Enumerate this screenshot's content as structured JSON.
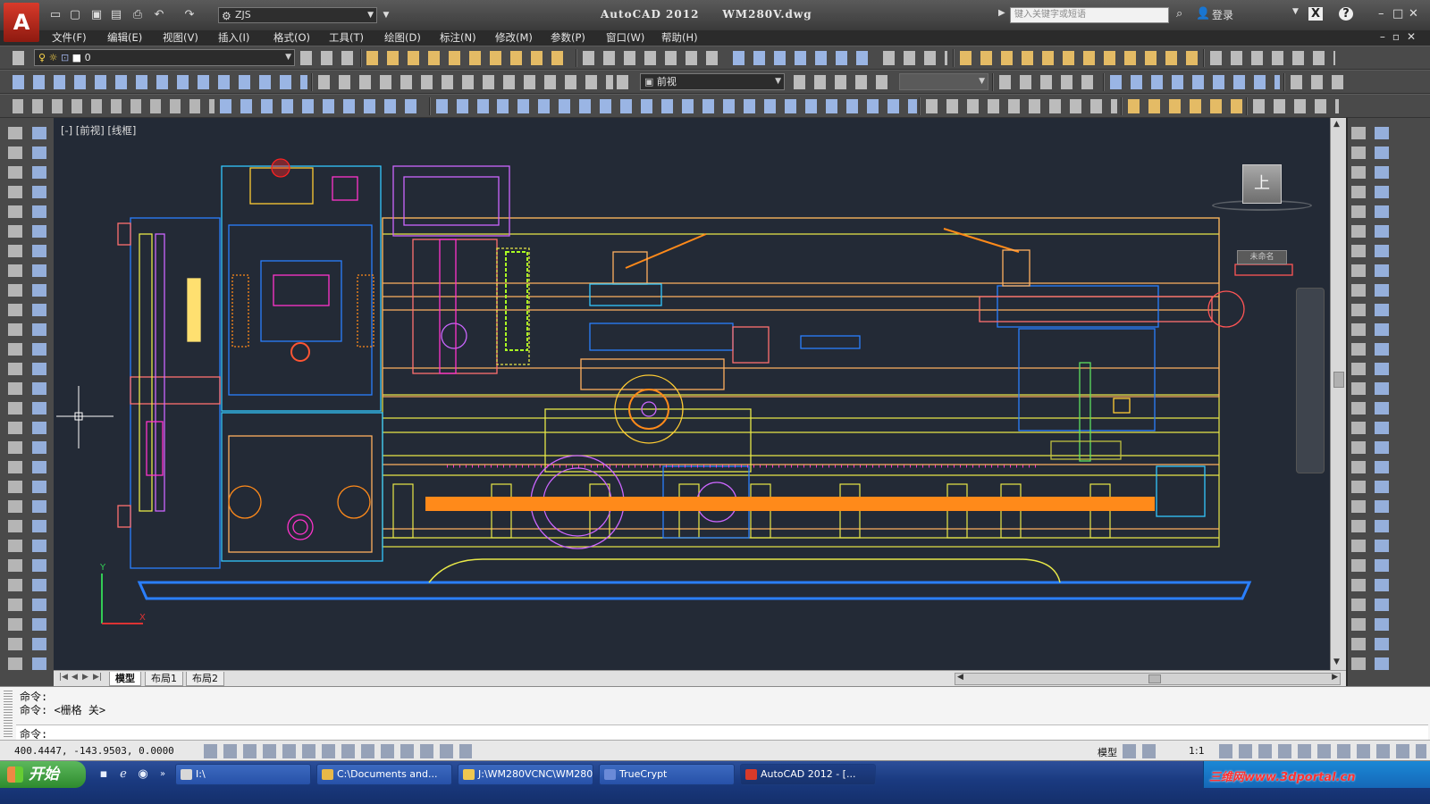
{
  "window": {
    "app_title": "AutoCAD 2012",
    "doc_title": "WM280V.dwg",
    "workspace": "ZJS",
    "search_placeholder": "键入关键字或短语",
    "login_label": "登录"
  },
  "menu": [
    "文件(F)",
    "编辑(E)",
    "视图(V)",
    "插入(I)",
    "格式(O)",
    "工具(T)",
    "绘图(D)",
    "标注(N)",
    "修改(M)",
    "参数(P)",
    "窗口(W)",
    "帮助(H)"
  ],
  "toolbar": {
    "layer_value": "0",
    "view_value": "前视"
  },
  "viewport": {
    "label": "[-] [前视] [线框]",
    "viewcube_face": "上",
    "wcs_label": "未命名"
  },
  "layout_tabs": [
    "模型",
    "布局1",
    "布局2"
  ],
  "command": {
    "history": [
      "命令:",
      "命令:  <栅格 关>"
    ],
    "prompt": "命令:"
  },
  "status": {
    "coords": "400.4447,  -143.9503, 0.0000",
    "model_label": "模型",
    "scale_label": "1:1"
  },
  "taskbar": {
    "start_label": "开始",
    "tasks": [
      {
        "label": "I:\\",
        "icon_color": "#d8d8d8"
      },
      {
        "label": "C:\\Documents and...",
        "icon_color": "#e8b848"
      },
      {
        "label": "J:\\WM280VCNC\\WM280V",
        "icon_color": "#f0c850"
      },
      {
        "label": "TrueCrypt",
        "icon_color": "#6a8ad8"
      },
      {
        "label": "AutoCAD 2012 - [...",
        "icon_color": "#d83a2a"
      }
    ],
    "watermark": "三维网www.3dportal.cn"
  },
  "colors": {
    "viewport_bg": "#232a36",
    "orange": "#ff8a1a",
    "blue": "#2a7fff",
    "yellow": "#e8e848",
    "cyan": "#33c8ff",
    "magenta": "#ff33cc"
  }
}
